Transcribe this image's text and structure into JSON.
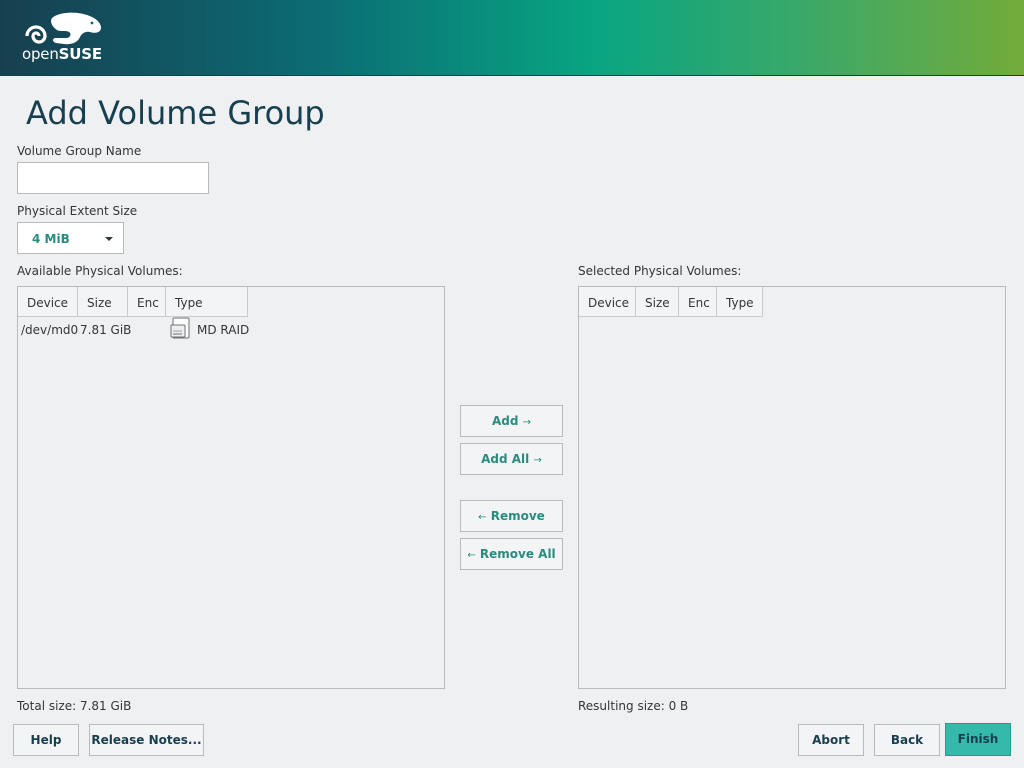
{
  "branding": {
    "logo_text_light": "open",
    "logo_text_bold": "SUSE"
  },
  "page": {
    "title": "Add Volume Group"
  },
  "form": {
    "vg_name_label": "Volume Group Name",
    "vg_name_value": "",
    "extent_label": "Physical Extent Size",
    "extent_value": "4 MiB"
  },
  "available": {
    "label": "Available Physical Volumes:",
    "columns": [
      "Device",
      "Size",
      "Enc",
      "Type"
    ],
    "rows": [
      {
        "device": "/dev/md0",
        "size": "7.81 GiB",
        "enc": "",
        "type": "MD RAID",
        "icon": "hard-disk-icon"
      }
    ],
    "total": "Total size: 7.81 GiB"
  },
  "selected": {
    "label": "Selected Physical Volumes:",
    "columns": [
      "Device",
      "Size",
      "Enc",
      "Type"
    ],
    "rows": [],
    "total": "Resulting size: 0 B"
  },
  "transfer": {
    "add": "Add",
    "add_all": "Add All",
    "remove": "Remove",
    "remove_all": "Remove All",
    "arrow_right": "→",
    "arrow_left": "←"
  },
  "footer": {
    "help": "Help",
    "release_notes": "Release Notes...",
    "abort": "Abort",
    "back": "Back",
    "finish": "Finish"
  },
  "colors": {
    "accent": "#2a8c7e",
    "primary_button": "#35b9ab",
    "title": "#173f4f"
  }
}
